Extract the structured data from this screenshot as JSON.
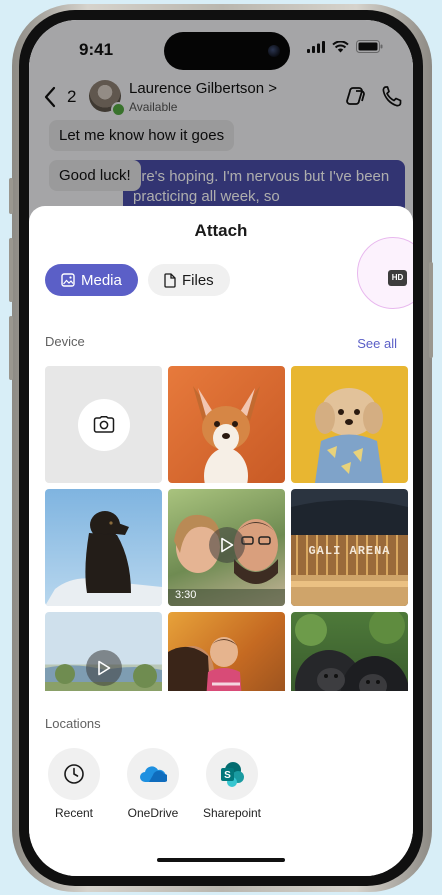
{
  "status_bar": {
    "time": "9:41"
  },
  "chat": {
    "back_count": "2",
    "contact_name": "Laurence Gilbertson >",
    "contact_status": "Available",
    "messages": [
      {
        "text": "Let me know how it goes"
      },
      {
        "text": "Good luck!"
      },
      {
        "text": "ere's hoping. I'm nervous but I've been practicing all week, so"
      }
    ]
  },
  "sheet": {
    "title": "Attach",
    "tabs": [
      {
        "label": "Media",
        "active": true
      },
      {
        "label": "Files",
        "active": false
      }
    ],
    "hd_label": "HD",
    "device_label": "Device",
    "see_all": "See all",
    "media": [
      {
        "kind": "camera",
        "icon": "camera-icon"
      },
      {
        "kind": "photo",
        "subject": "corgi puppy"
      },
      {
        "kind": "photo",
        "subject": "poodle in sweater"
      },
      {
        "kind": "photo",
        "subject": "black labrador"
      },
      {
        "kind": "video",
        "subject": "selfie couple",
        "duration": "3:30"
      },
      {
        "kind": "photo",
        "subject": "arena",
        "caption": "GALI ARENA"
      },
      {
        "kind": "video",
        "subject": "coastline"
      },
      {
        "kind": "photo",
        "subject": "mother and baby"
      },
      {
        "kind": "photo",
        "subject": "gorillas"
      }
    ],
    "locations_label": "Locations",
    "locations": [
      {
        "label": "Recent",
        "icon": "clock-icon"
      },
      {
        "label": "OneDrive",
        "icon": "onedrive-icon"
      },
      {
        "label": "Sharepoint",
        "icon": "sharepoint-icon"
      }
    ]
  },
  "colors": {
    "accent": "#5b5fc7",
    "background": "#d8eef7",
    "sent_bubble": "#4a4da8"
  }
}
